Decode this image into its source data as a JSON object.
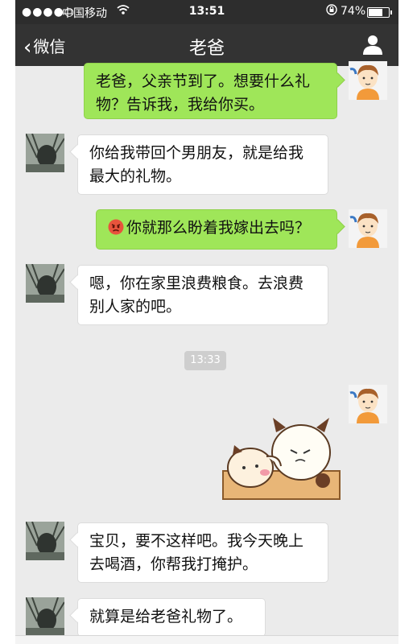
{
  "status_bar": {
    "signal": "●●●●○",
    "carrier": "中国移动",
    "time": "13:51",
    "battery": "74%"
  },
  "nav": {
    "back_label": "微信",
    "title": "老爸"
  },
  "messages": [
    {
      "side": "right",
      "text": "老爸，父亲节到了。想要什么礼物？告诉我，我给你买。"
    },
    {
      "side": "left",
      "text": "你给我带回个男朋友，就是给我最大的礼物。"
    },
    {
      "side": "right",
      "text": "你就那么盼着我嫁出去吗？",
      "emoji": "angry-face"
    },
    {
      "side": "left",
      "text": "嗯，你在家里浪费粮食。去浪费别人家的吧。"
    },
    {
      "side": "right",
      "type": "sticker",
      "sticker": "cartoon-panda-bears-hugging"
    },
    {
      "side": "left",
      "text": "宝贝，要不这样吧。我今天晚上去喝酒，你帮我打掩护。"
    },
    {
      "side": "left",
      "text": "就算是给老爸礼物了。"
    }
  ],
  "timestamp": "13:33",
  "colors": {
    "nav_bg": "#333333",
    "chat_bg": "#ebebeb",
    "right_bubble": "#9fe659",
    "left_bubble": "#ffffff"
  }
}
